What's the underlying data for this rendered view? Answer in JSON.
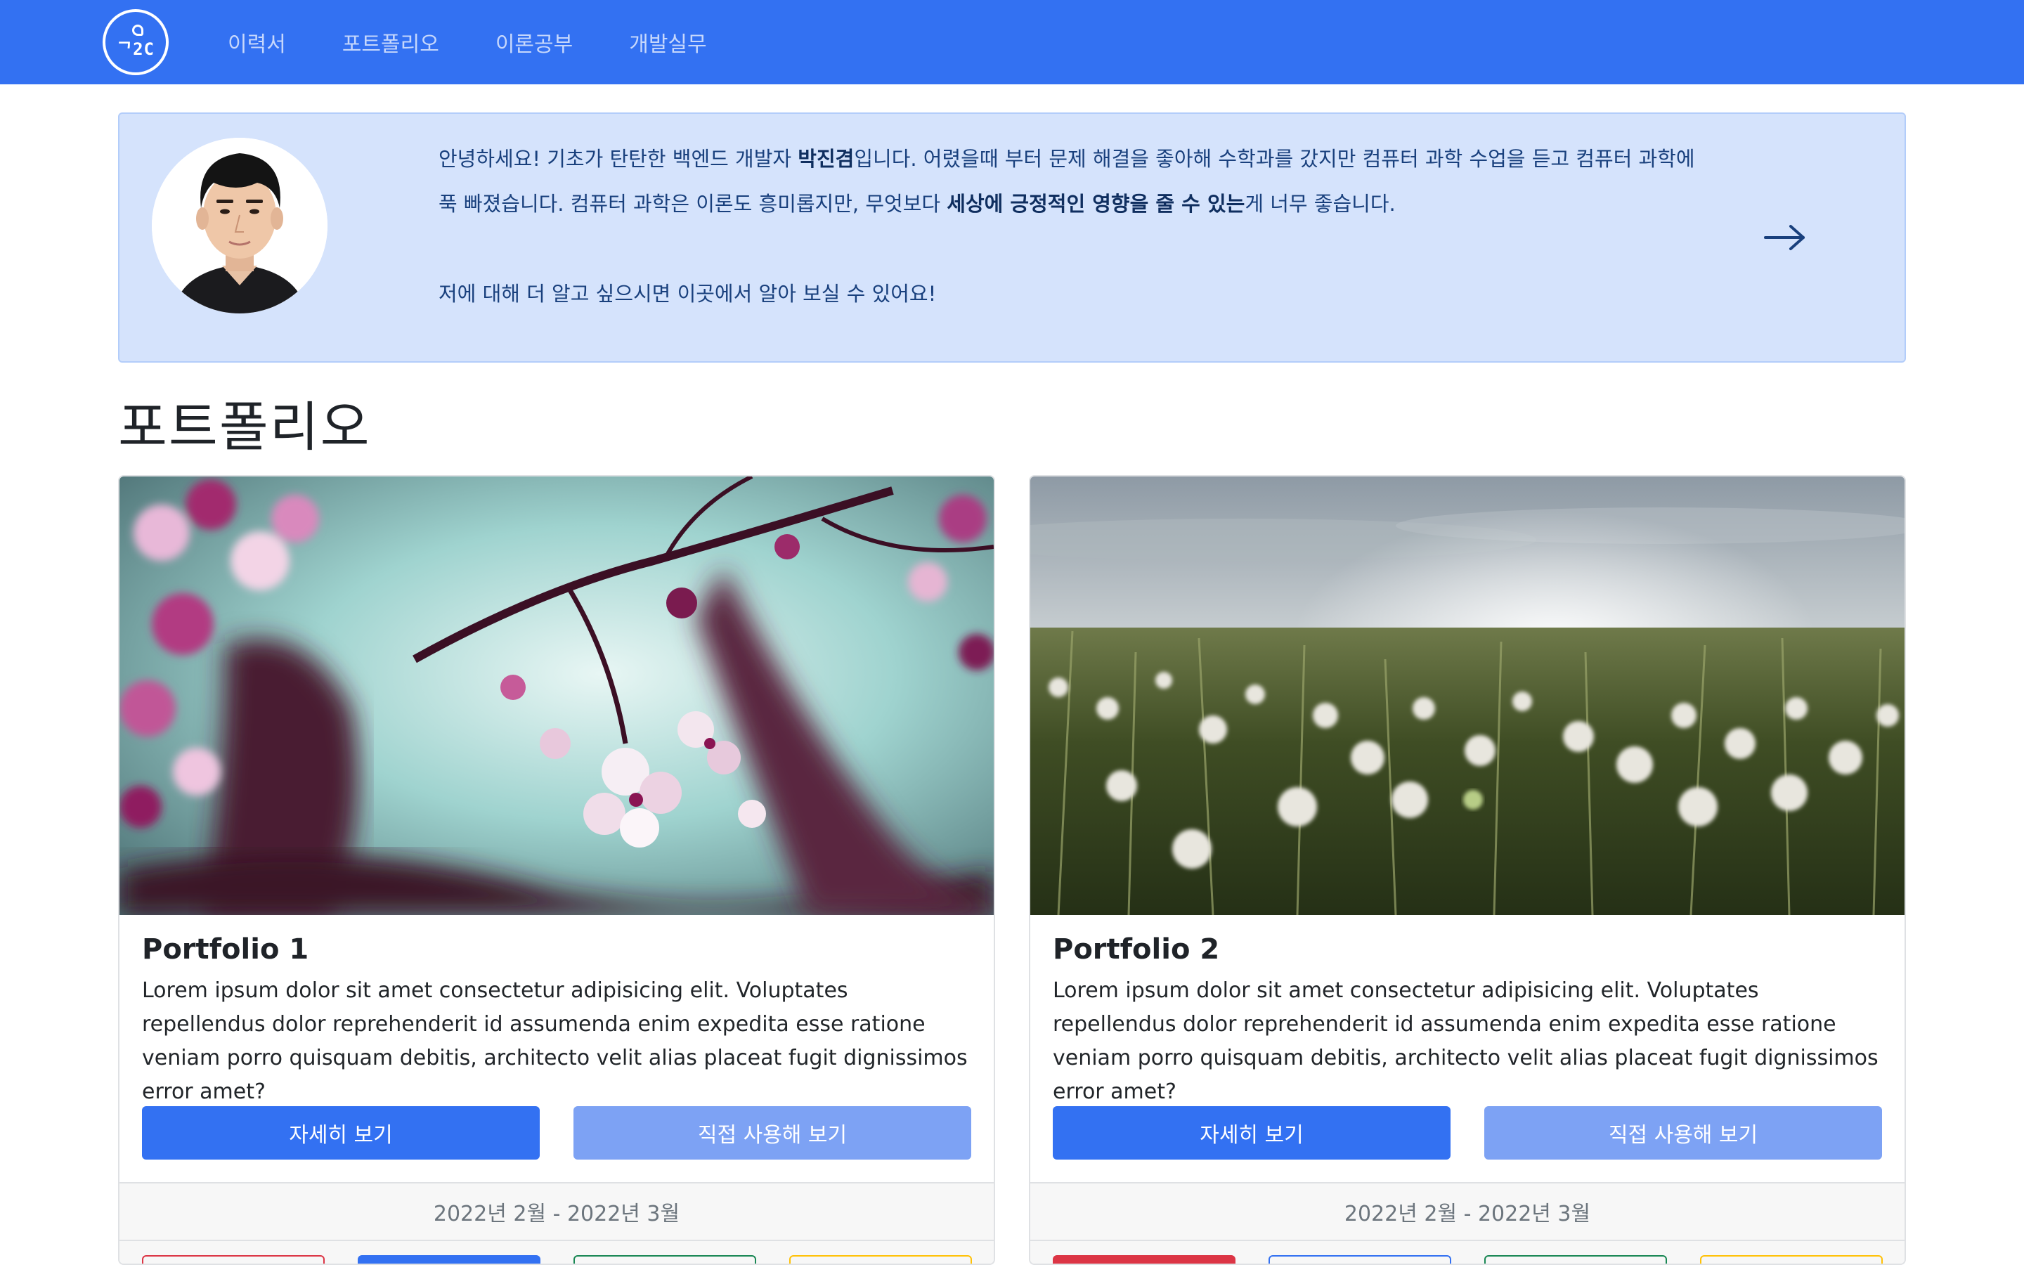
{
  "navbar": {
    "logo_text": "ᄀ2C",
    "links": [
      "이력서",
      "포트폴리오",
      "이론공부",
      "개발실무"
    ],
    "background": "#3371f2"
  },
  "intro": {
    "line1_a": "안녕하세요! 기초가 탄탄한 백엔드 개발자 ",
    "line1_name": "박진겸",
    "line1_b": "입니다. 어렸을때 부터 문제 해결을 좋아해 수학과를 갔지만 컴퓨터 과학 수업을 듣고 컴퓨터 과학에",
    "line2_a": "푹 빠졌습니다. 컴퓨터 과학은 이론도 흥미롭지만, 무엇보다 ",
    "line2_bold": "세상에 긍정적인 영향을 줄 수 있는",
    "line2_b": "게 너무 좋습니다.",
    "line3": "저에 대해 더 알고 싶으시면 이곳에서 알아 보실 수 있어요!",
    "arrow_icon": "arrow-right-icon",
    "background": "#d5e3fc"
  },
  "section": {
    "title": "포트폴리오"
  },
  "cards": [
    {
      "title": "Portfolio 1",
      "text": "Lorem ipsum dolor sit amet consectetur adipisicing elit. Voluptates repellendus dolor reprehenderit id assumenda enim expedita esse ratione veniam porro quisquam debitis, architecto velit alias placeat fugit dignissimos error amet?",
      "detail_button": "자세히 보기",
      "try_button": "직접 사용해 보기",
      "date": "2022년 2월 - 2022년 3월",
      "image": "cherry-blossom-photo",
      "tag_colors": [
        "#dc3545",
        "#3371f2",
        "#198754",
        "#ffc107"
      ]
    },
    {
      "title": "Portfolio 2",
      "text": "Lorem ipsum dolor sit amet consectetur adipisicing elit. Voluptates repellendus dolor reprehenderit id assumenda enim expedita esse ratione veniam porro quisquam debitis, architecto velit alias placeat fugit dignissimos error amet?",
      "detail_button": "자세히 보기",
      "try_button": "직접 사용해 보기",
      "date": "2022년 2월 - 2022년 3월",
      "image": "dandelion-field-photo",
      "tag_colors": [
        "#dc3545",
        "#3371f2",
        "#198754",
        "#ffc107"
      ]
    }
  ]
}
